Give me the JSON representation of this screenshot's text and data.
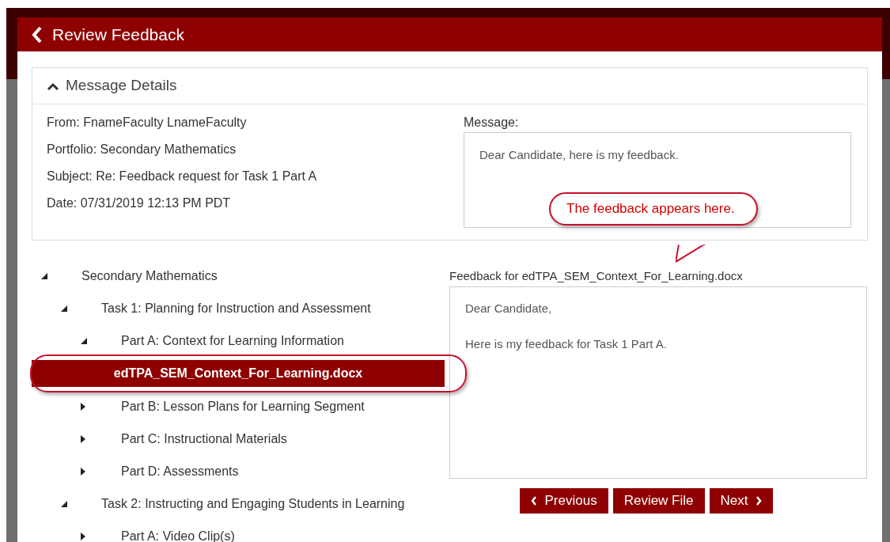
{
  "header": {
    "title": "Review Feedback"
  },
  "message_details": {
    "title": "Message Details",
    "expanded": true,
    "fields": [
      "From: FnameFaculty LnameFaculty",
      "Portfolio: Secondary Mathematics",
      "Subject: Re: Feedback request for Task 1 Part A",
      "Date: 07/31/2019 12:13 PM PDT"
    ],
    "message_label": "Message:",
    "message": "Dear Candidate, here is my feedback."
  },
  "tree": [
    {
      "label": "Secondary Mathematics",
      "expanded": true,
      "children": [
        {
          "label": "Task 1: Planning for Instruction and Assessment",
          "expanded": true,
          "children": [
            {
              "label": "Part A: Context for Learning Information",
              "expanded": true,
              "children": [
                {
                  "kind": "file",
                  "label": "edTPA_SEM_Context_For_Learning.docx",
                  "selected": true
                }
              ]
            },
            {
              "label": "Part B: Lesson Plans for Learning Segment",
              "expanded": false
            },
            {
              "label": "Part C: Instructional Materials",
              "expanded": false
            },
            {
              "label": "Part D: Assessments",
              "expanded": false
            }
          ]
        },
        {
          "label": "Task 2: Instructing and Engaging Students in Learning",
          "expanded": true,
          "children": [
            {
              "label": "Part A: Video Clip(s)",
              "expanded": false
            }
          ]
        }
      ]
    }
  ],
  "feedback": {
    "label": "Feedback for edTPA_SEM_Context_For_Learning.docx",
    "paragraphs": [
      "Dear Candidate,",
      "Here is my feedback for Task 1 Part A."
    ]
  },
  "buttons": [
    {
      "kind": "previous",
      "label": "Previous"
    },
    {
      "kind": "plain",
      "label": "Review File"
    },
    {
      "kind": "next",
      "label": "Next"
    }
  ],
  "callout": {
    "text": "The feedback appears here."
  }
}
